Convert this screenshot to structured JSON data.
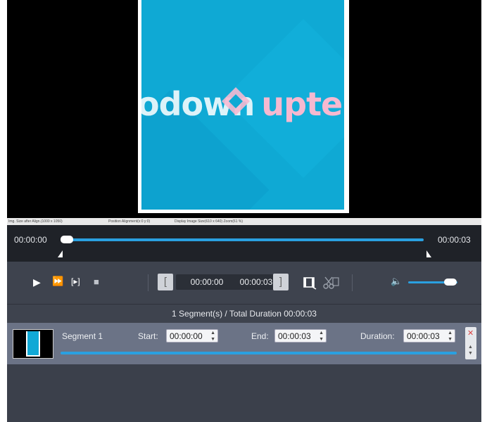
{
  "viewer": {
    "logo_text_a": "odown",
    "logo_text_b": "upte"
  },
  "status_bar": {
    "img_size": "Img. Size after Align.(1000 x 1050)",
    "position": "Position Alignment(x:0 y:0)",
    "display": "Display Image Size(610 x 640)  Zoom(61 %)"
  },
  "timeline": {
    "current_time": "00:00:00",
    "end_time": "00:00:03",
    "progress": 0.0
  },
  "controls": {
    "play_icon": "▶",
    "fast_forward_icon": "⏩",
    "frame_step_icon": "[▸]",
    "stop_icon": "■",
    "bracket_open": "[",
    "bracket_close": "]",
    "start_time": "00:00:00",
    "end_time": "00:00:03",
    "volume_icon": "🔈",
    "volume_level": 0.85
  },
  "summary": {
    "text": "1 Segment(s) / Total Duration 00:00:03"
  },
  "segments": [
    {
      "name": "Segment 1",
      "start_label": "Start:",
      "start_value": "00:00:00",
      "end_label": "End:",
      "end_value": "00:00:03",
      "duration_label": "Duration:",
      "duration_value": "00:00:03"
    }
  ],
  "colors": {
    "accent": "#2aa0e0",
    "frame_bg": "#0fa9d4",
    "logo_pink": "#f6b9d0"
  }
}
